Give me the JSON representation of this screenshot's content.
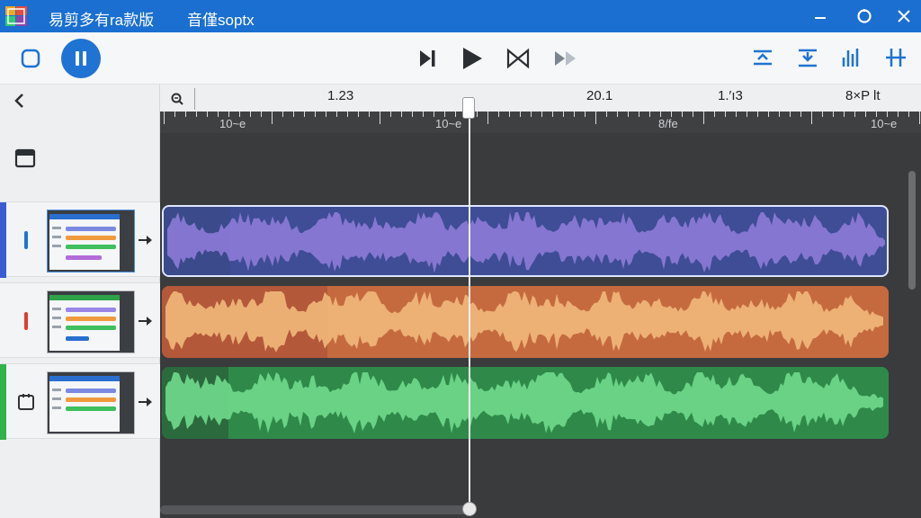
{
  "titlebar": {
    "title": "易剪多有ra款版",
    "subtitle": "音僅soptx",
    "logo_icon": "app-logo-icon",
    "minimize_icon": "minimize-icon",
    "restore_icon": "restore-icon",
    "close_icon": "close-icon"
  },
  "toolbar": {
    "loop_icon": "loop-icon",
    "pause_icon": "pause-icon",
    "skip_end_icon": "skip-to-end-icon",
    "play_icon": "play-icon",
    "bowtie_icon": "bowtie-icon",
    "fast_forward_icon": "fast-forward-icon",
    "align_top_icon": "align-top-icon",
    "align_bottom_icon": "align-bottom-icon",
    "levels_icon": "levels-icon",
    "split_icon": "split-icon",
    "accent_color": "#1f73d2"
  },
  "left_panel": {
    "back_icon": "chevron-left-icon",
    "folder_icon": "folder-icon",
    "tracks": [
      {
        "accent": "#3d5bd0",
        "icon": "track-marker-icon",
        "icon_color": "#1f73d2",
        "selected": true
      },
      {
        "accent": "",
        "icon": "track-marker-icon",
        "icon_color": "#e03c2e",
        "selected": false
      },
      {
        "accent": "#2fb34a",
        "icon": "clipboard-icon",
        "icon_color": "#333333",
        "selected": false
      }
    ]
  },
  "ruler": {
    "labels": [
      "1.23",
      "20.1",
      "1.′ı3",
      "8×P lt"
    ],
    "sub_labels": [
      "10~e",
      "10~e",
      "8/fe",
      "10~e"
    ]
  },
  "clips": [
    {
      "color": "#8b7ad6",
      "dark": "#3b4a8a",
      "bg": "#3e4d95"
    },
    {
      "color": "#f0b679",
      "dark": "#b4583a",
      "bg": "#c56a3f"
    },
    {
      "color": "#6fd88a",
      "dark": "#2a6a3d",
      "bg": "#2f8a4a"
    }
  ],
  "playhead": {
    "position": 0.41
  }
}
